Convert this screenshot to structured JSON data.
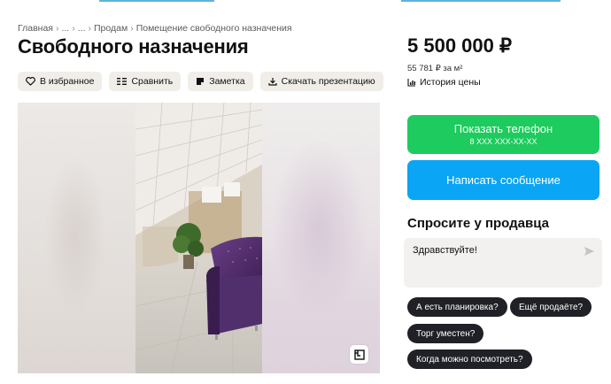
{
  "breadcrumb": [
    "Главная",
    "...",
    "...",
    "Продам",
    "Помещение свободного назначения"
  ],
  "title": "Свободного назначения",
  "actions": {
    "favorite": "В избранное",
    "compare": "Сравнить",
    "note": "Заметка",
    "download": "Скачать презентацию"
  },
  "price": {
    "value": "5 500 000 ₽",
    "per_m2": "55 781 ₽ за м²",
    "history": "История цены"
  },
  "contact": {
    "show_phone": "Показать телефон",
    "phone_mask": "8 XXX XXX-XX-XX",
    "write_message": "Написать сообщение"
  },
  "ask": {
    "title": "Спросите у продавца",
    "message_value": "Здравствуйте!",
    "chips": [
      "А есть планировка?",
      "Ещё продаёте?",
      "Торг уместен?",
      "Когда можно посмотреть?"
    ]
  },
  "colors": {
    "phone_button": "#1ecb5e",
    "message_button": "#0aa5f5",
    "chip_bg": "#1f2126",
    "action_bg": "#f1eee9"
  },
  "icons": {
    "favorite": "heart-icon",
    "compare": "compare-icon",
    "note": "note-icon",
    "download": "download-icon",
    "history": "chart-icon",
    "send": "send-icon",
    "gallery": "floorplan-icon"
  }
}
